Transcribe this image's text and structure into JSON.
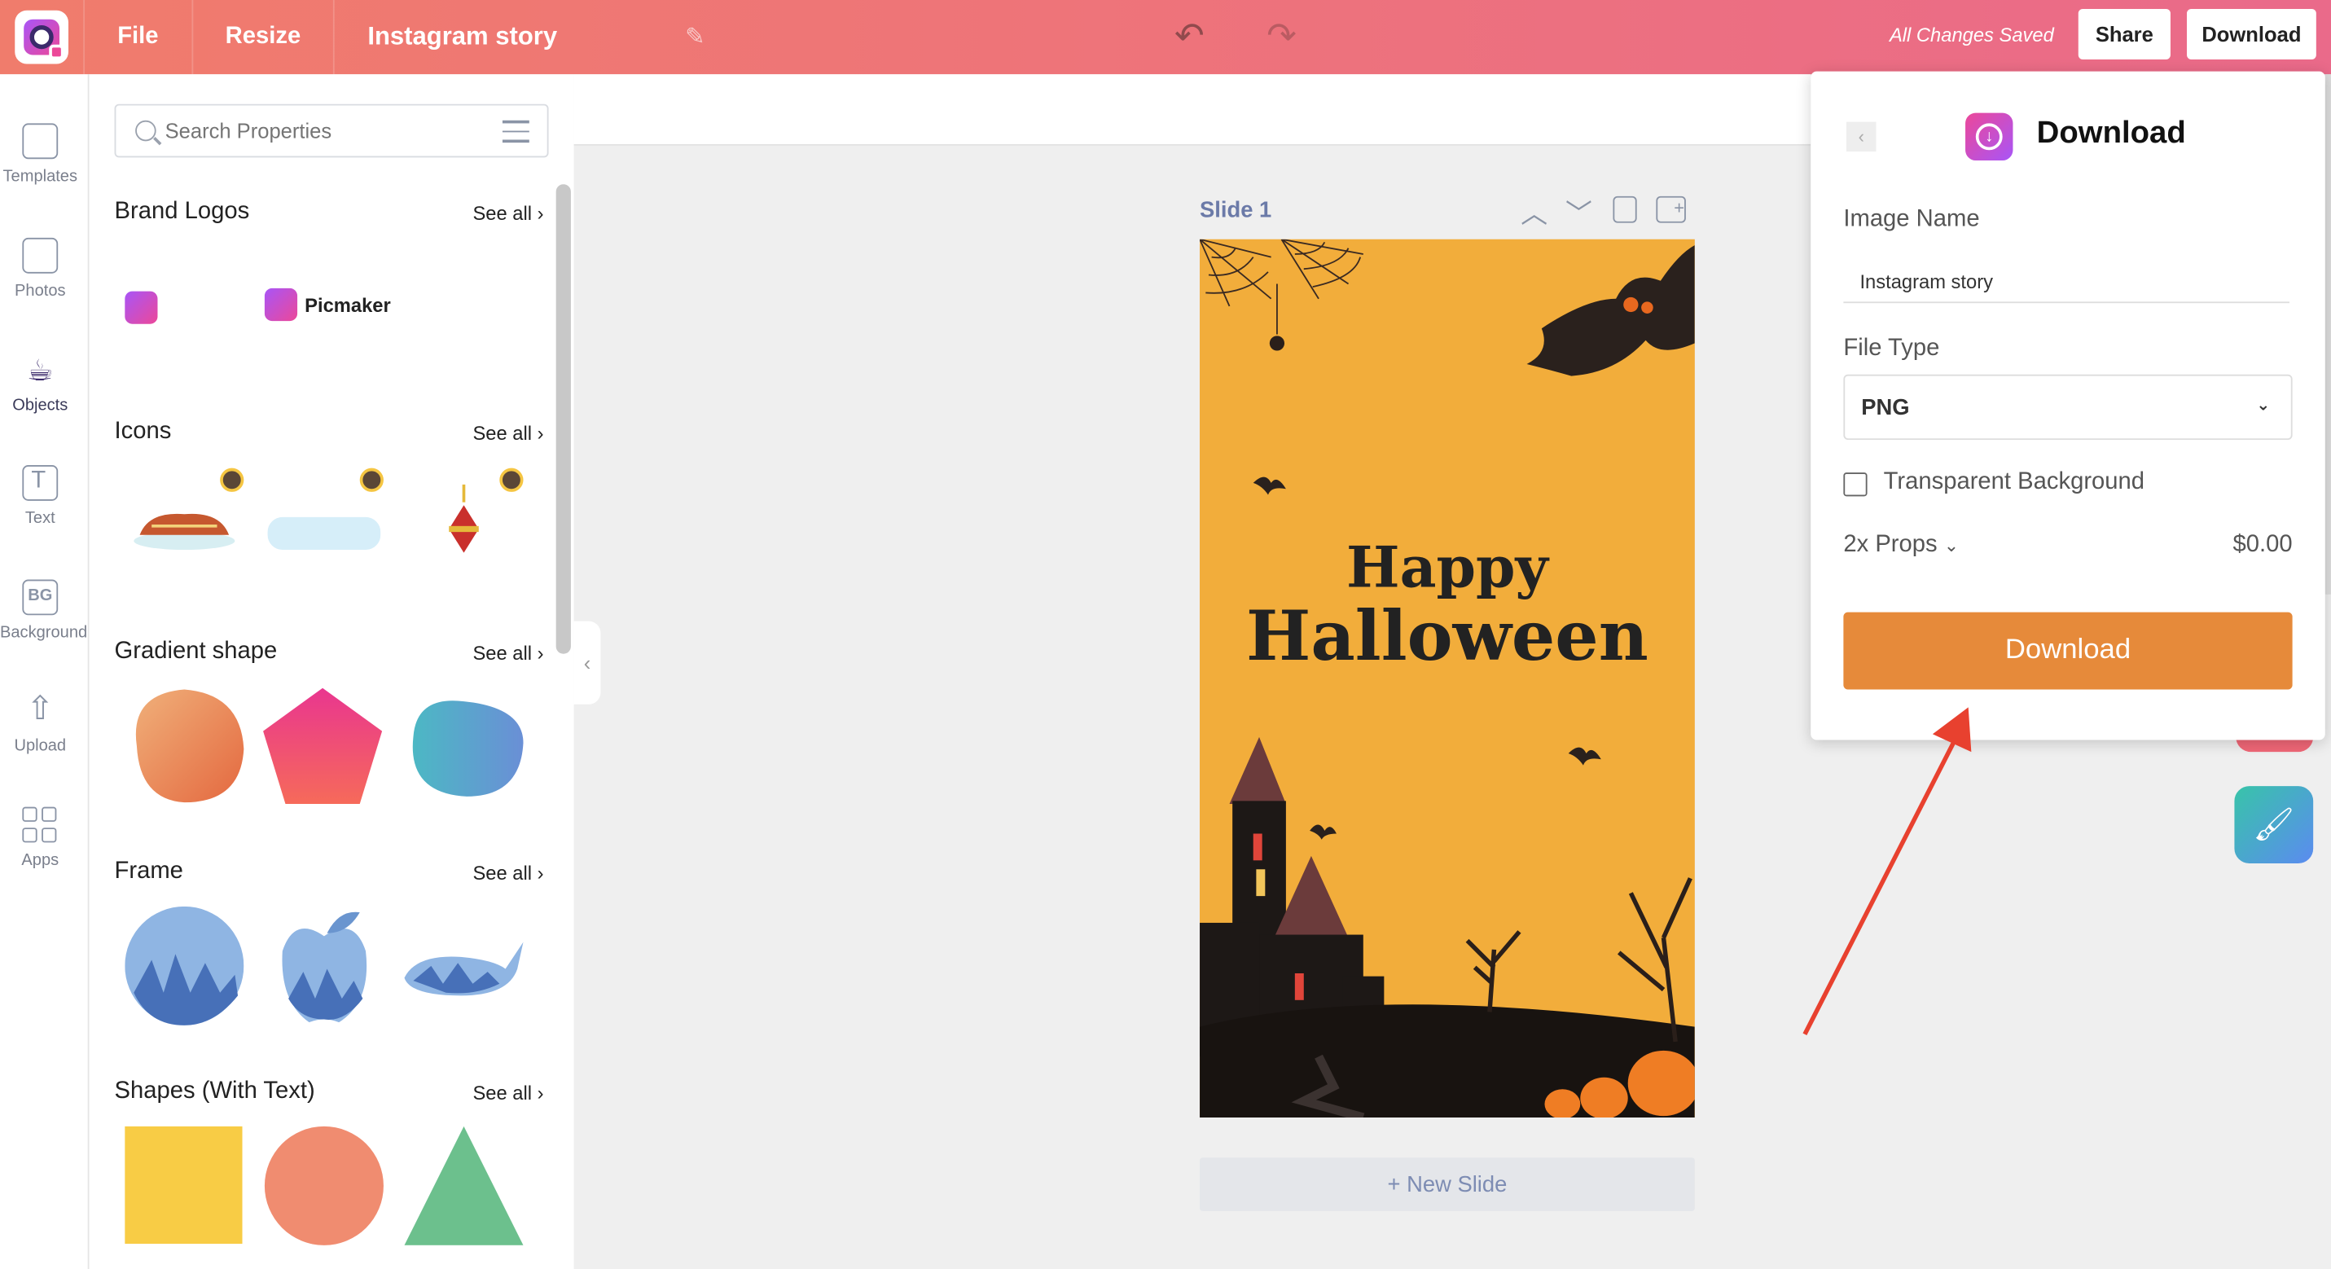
{
  "header": {
    "menu_file": "File",
    "menu_resize": "Resize",
    "doc_title": "Instagram story",
    "status": "All Changes Saved",
    "share_label": "Share",
    "download_label": "Download"
  },
  "rail": {
    "items": [
      {
        "label": "Templates",
        "icon": "templates-icon"
      },
      {
        "label": "Photos",
        "icon": "photos-icon"
      },
      {
        "label": "Objects",
        "icon": "objects-icon"
      },
      {
        "label": "Text",
        "icon": "text-icon"
      },
      {
        "label": "Background",
        "icon": "background-icon"
      },
      {
        "label": "Upload",
        "icon": "upload-icon"
      },
      {
        "label": "Apps",
        "icon": "apps-icon"
      }
    ],
    "bg_glyph": "BG"
  },
  "panel": {
    "search_placeholder": "Search Properties",
    "see_all": "See all",
    "sections": [
      {
        "title": "Brand Logos"
      },
      {
        "title": "Icons"
      },
      {
        "title": "Gradient shape"
      },
      {
        "title": "Frame"
      },
      {
        "title": "Shapes (With Text)"
      }
    ],
    "brand_name": "Picmaker"
  },
  "canvas": {
    "slide_label": "Slide 1",
    "new_slide": "+ New Slide",
    "design_line1": "Happy",
    "design_line2": "Halloween"
  },
  "download_panel": {
    "title": "Download",
    "image_name_label": "Image Name",
    "image_name_value": "Instagram story",
    "file_type_label": "File Type",
    "file_type_value": "PNG",
    "transparent_label": "Transparent Background",
    "props_label": "2x Props",
    "price": "$0.00",
    "button_label": "Download"
  },
  "colors": {
    "header_start": "#f07c6c",
    "header_end": "#ea6a8a",
    "download_button": "#e68a3a",
    "slide_bg": "#f2ad3b",
    "annotation_arrow": "#e8412f"
  }
}
